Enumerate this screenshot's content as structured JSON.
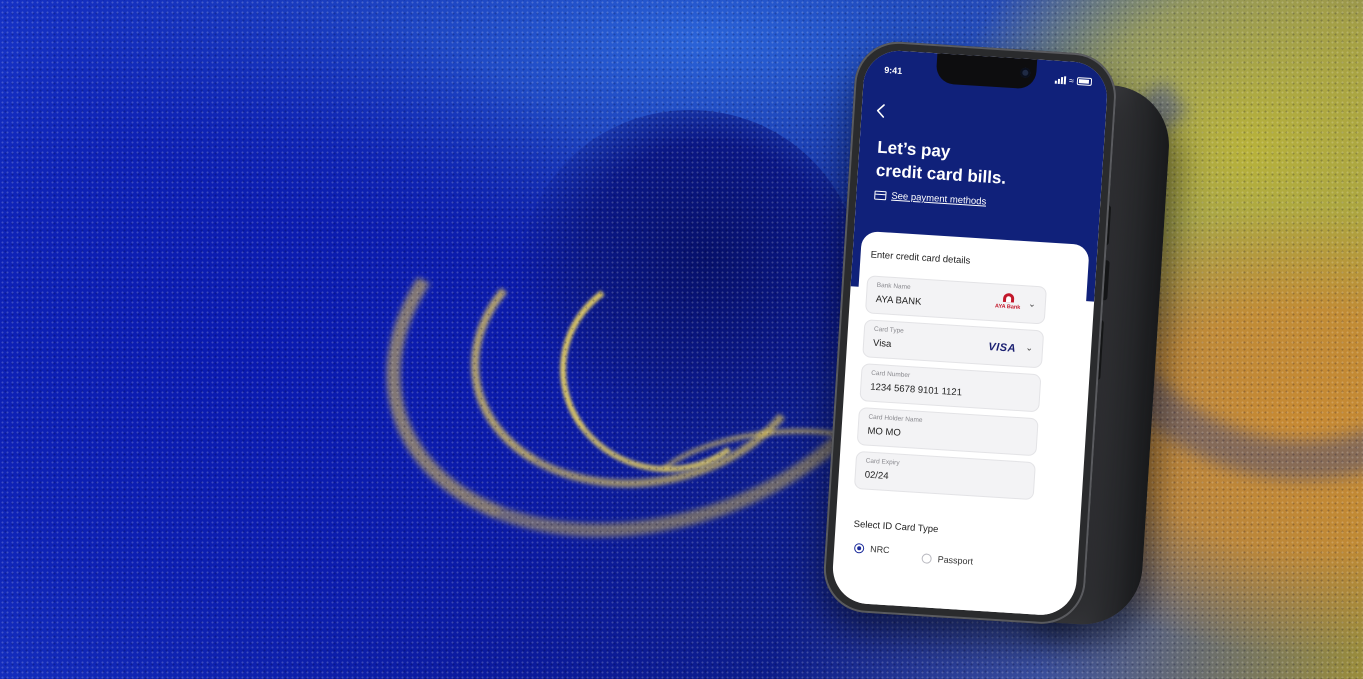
{
  "status": {
    "time": "9:41"
  },
  "header": {
    "title_line1": "Let’s pay",
    "title_line2": "credit card bills.",
    "payment_link": "See payment methods"
  },
  "form": {
    "heading": "Enter credit card details",
    "bank": {
      "label": "Bank Name",
      "value": "AYA BANK",
      "logo_text": "AYA Bank"
    },
    "card_type": {
      "label": "Card Type",
      "value": "Visa",
      "logo_text": "VISA"
    },
    "card_number": {
      "label": "Card Number",
      "value": "1234 5678 9101 1121"
    },
    "holder": {
      "label": "Card Holder Name",
      "value": "MO MO"
    },
    "expiry": {
      "label": "Card Expiry",
      "value": "02/24"
    }
  },
  "id_type": {
    "heading": "Select ID Card Type",
    "options": [
      {
        "label": "NRC",
        "selected": true
      },
      {
        "label": "Passport",
        "selected": false
      }
    ]
  },
  "colors": {
    "header_bg": "#10217a",
    "accent": "#1a2a9a",
    "aya_red": "#c2182b",
    "visa_blue": "#1a1f71"
  },
  "icons": [
    "back-arrow-icon",
    "credit-card-icon",
    "chevron-down-icon",
    "signal-icon",
    "wifi-icon",
    "battery-icon"
  ]
}
